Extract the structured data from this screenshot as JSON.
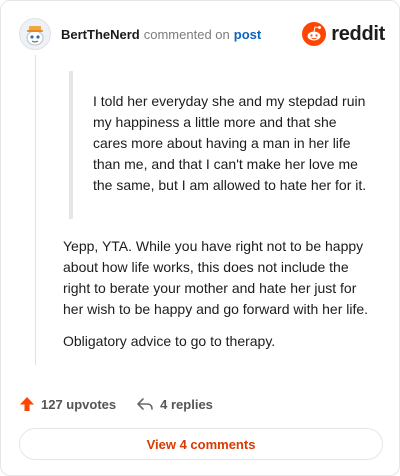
{
  "header": {
    "username": "BertTheNerd",
    "action_text": "commented on",
    "post_link": "post",
    "brand": "reddit"
  },
  "quote": {
    "text": "I told her everyday she and my stepdad ruin my happiness a little more and that she cares more about having a man in her life than me, and that I can't make her love me the same, but I am allowed to hate her for it."
  },
  "comment": {
    "paragraphs": [
      "Yepp, YTA. While you have right not to be happy about how life works, this does not include the right to berate your mother and hate her just for her wish to be happy and go forward with her life.",
      "Obligatory advice to go to therapy."
    ]
  },
  "footer": {
    "upvotes": "127 upvotes",
    "replies": "4 replies",
    "view_comments": "View 4 comments"
  },
  "colors": {
    "accent": "#FF4500",
    "link": "#0a66c2",
    "view_button_text": "#d93a00"
  },
  "icons": {
    "avatar": "snoo-avatar-icon",
    "brand": "reddit-logo-icon",
    "upvote": "upvote-arrow-icon",
    "reply": "reply-arrow-icon"
  }
}
